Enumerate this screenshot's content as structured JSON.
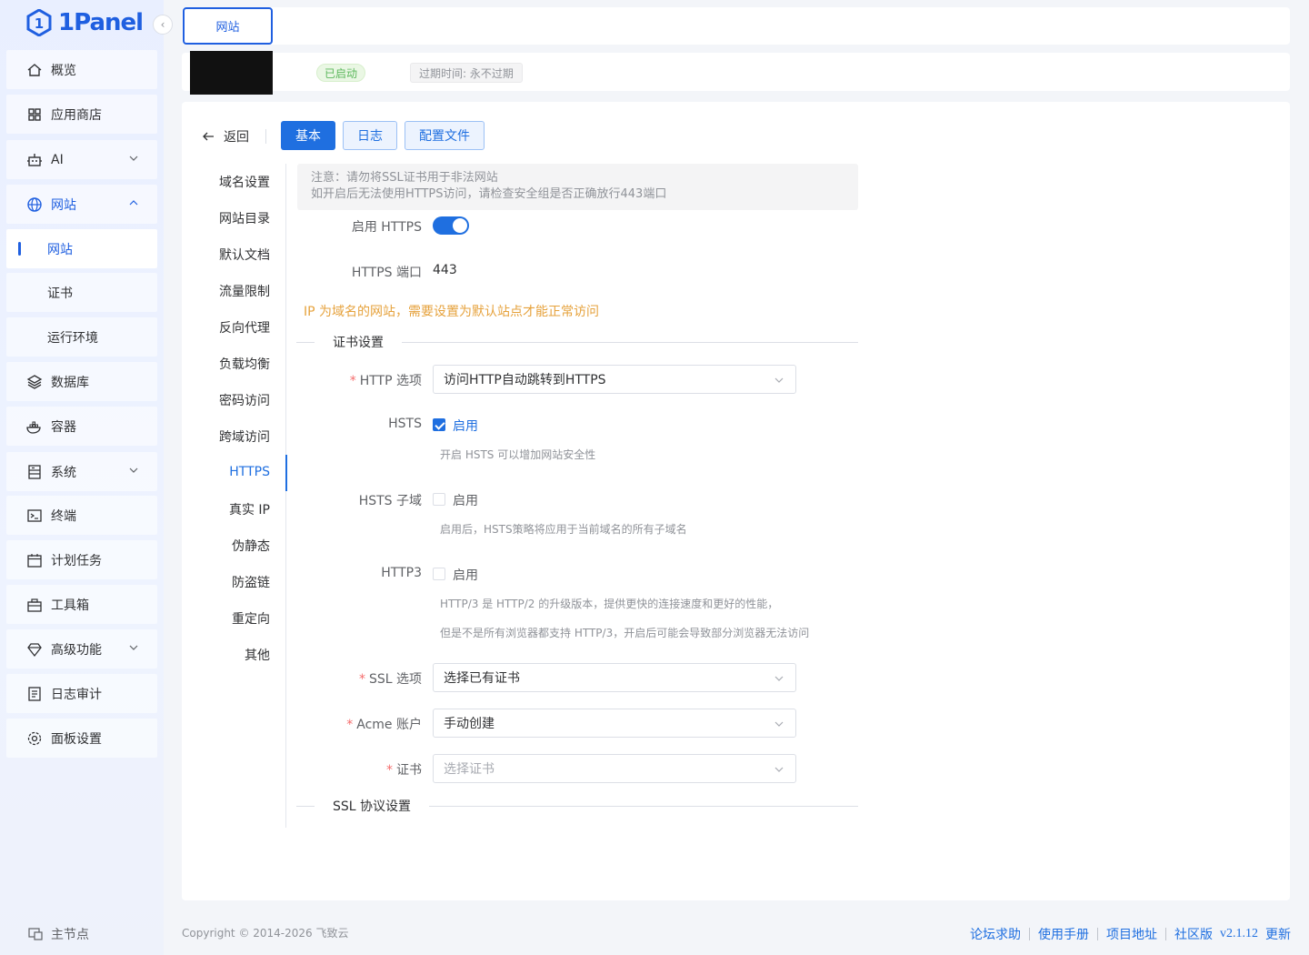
{
  "brand": {
    "name": "1Panel"
  },
  "sidebar": {
    "items": [
      {
        "label": "概览",
        "icon": "home-icon"
      },
      {
        "label": "应用商店",
        "icon": "grid-icon"
      },
      {
        "label": "AI",
        "icon": "robot-icon"
      },
      {
        "label": "网站",
        "icon": "globe-icon"
      },
      {
        "label": "网站",
        "icon": ""
      },
      {
        "label": "证书",
        "icon": ""
      },
      {
        "label": "运行环境",
        "icon": ""
      },
      {
        "label": "数据库",
        "icon": "layers-icon"
      },
      {
        "label": "容器",
        "icon": "docker-icon"
      },
      {
        "label": "系统",
        "icon": "server-icon"
      },
      {
        "label": "终端",
        "icon": "terminal-icon"
      },
      {
        "label": "计划任务",
        "icon": "calendar-icon"
      },
      {
        "label": "工具箱",
        "icon": "toolbox-icon"
      },
      {
        "label": "高级功能",
        "icon": "diamond-icon"
      },
      {
        "label": "日志审计",
        "icon": "log-icon"
      },
      {
        "label": "面板设置",
        "icon": "gear-icon"
      }
    ],
    "footer_node": "主节点"
  },
  "tabs": {
    "active": "网站"
  },
  "status": {
    "running": "已启动",
    "expire": "过期时间: 永不过期"
  },
  "toolbar": {
    "back": "返回",
    "basic": "基本",
    "log": "日志",
    "config": "配置文件"
  },
  "side_nav": [
    "域名设置",
    "网站目录",
    "默认文档",
    "流量限制",
    "反向代理",
    "负载均衡",
    "密码访问",
    "跨域访问",
    "HTTPS",
    "真实 IP",
    "伪静态",
    "防盗链",
    "重定向",
    "其他"
  ],
  "notice": {
    "line1": "注意：请勿将SSL证书用于非法网站",
    "line2": "如开启后无法使用HTTPS访问，请检查安全组是否正确放行443端口"
  },
  "form": {
    "enable_https_label": "启用 HTTPS",
    "enable_https": true,
    "https_port_label": "HTTPS 端口",
    "https_port": "443",
    "ip_warning": "IP 为域名的网站，需要设置为默认站点才能正常访问",
    "cert_section": "证书设置",
    "http_option_label": "HTTP 选项",
    "http_option_value": "访问HTTP自动跳转到HTTPS",
    "hsts_label": "HSTS",
    "hsts_enable": "启用",
    "hsts_checked": true,
    "hsts_help": "开启 HSTS 可以增加网站安全性",
    "hsts_sub_label": "HSTS 子域",
    "hsts_sub_enable": "启用",
    "hsts_sub_help": "启用后，HSTS策略将应用于当前域名的所有子域名",
    "http3_label": "HTTP3",
    "http3_enable": "启用",
    "http3_help1": "HTTP/3 是 HTTP/2 的升级版本，提供更快的连接速度和更好的性能，",
    "http3_help2": "但是不是所有浏览器都支持 HTTP/3，开启后可能会导致部分浏览器无法访问",
    "ssl_option_label": "SSL 选项",
    "ssl_option_value": "选择已有证书",
    "acme_label": "Acme 账户",
    "acme_value": "手动创建",
    "cert_label": "证书",
    "cert_placeholder": "选择证书",
    "ssl_protocol_section": "SSL 协议设置"
  },
  "footer": {
    "copyright": "Copyright © 2014-2026 飞致云",
    "links": [
      "论坛求助",
      "使用手册",
      "项目地址",
      "社区版"
    ],
    "version": "v2.1.12",
    "update": "更新"
  },
  "colors": {
    "primary": "#1f6fe0",
    "warning": "#e6a23c",
    "success": "#5cb85c"
  }
}
